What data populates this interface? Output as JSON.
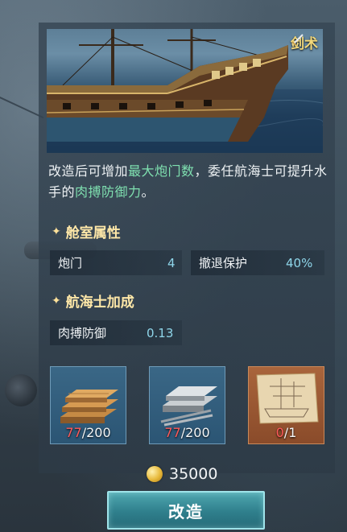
{
  "ship_tag": {
    "icon": "sword-icon",
    "label": "剑术"
  },
  "description": {
    "part1": "改造后可增加",
    "highlight1": "最大炮门数",
    "part2": "，委任航海士可提升水手的",
    "highlight2": "肉搏防御力",
    "part3": "。",
    "highlight_color": "#7fe0b0"
  },
  "cabin_section": {
    "title": "舱室属性",
    "stats": [
      {
        "label": "炮门",
        "value": "4"
      },
      {
        "label": "撤退保护",
        "value": "40%"
      }
    ]
  },
  "navigator_section": {
    "title": "航海士加成",
    "stats": [
      {
        "label": "肉搏防御",
        "value": "0.13"
      }
    ]
  },
  "materials": [
    {
      "name": "wood-planks",
      "icon": "wood-planks-icon",
      "owned": "77",
      "required": "/200"
    },
    {
      "name": "iron-plates",
      "icon": "iron-plates-icon",
      "owned": "77",
      "required": "/200"
    },
    {
      "name": "ship-blueprint",
      "icon": "blueprint-icon",
      "owned": "0",
      "required": "/1"
    }
  ],
  "cost": {
    "icon": "coin-icon",
    "amount": "35000"
  },
  "action_button": {
    "label": "改造"
  },
  "colors": {
    "insufficient": "#ff5a5a",
    "accent": "#ffe8a8",
    "value": "#8fd6ea"
  }
}
